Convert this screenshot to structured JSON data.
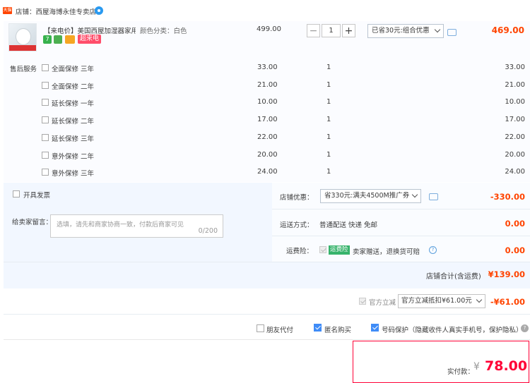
{
  "shop": {
    "badge": "天猫",
    "label": "店铺：西屋海博永佳专卖店"
  },
  "item": {
    "title": "【来电价】美国西屋加湿器家用...",
    "sku": "颜色分类：白色",
    "tag_seven": "7",
    "tag_hot": "超来电",
    "price": "499.00",
    "quantity": "1",
    "promo": "已省30元:组合优惠",
    "subtotal": "469.00"
  },
  "services": {
    "label": "售后服务",
    "rows": [
      {
        "name": "全面保修 三年",
        "price": "33.00",
        "qty": "1",
        "sum": "33.00"
      },
      {
        "name": "全面保修 二年",
        "price": "21.00",
        "qty": "1",
        "sum": "21.00"
      },
      {
        "name": "延长保修 一年",
        "price": "10.00",
        "qty": "1",
        "sum": "10.00"
      },
      {
        "name": "延长保修 二年",
        "price": "17.00",
        "qty": "1",
        "sum": "17.00"
      },
      {
        "name": "延长保修 三年",
        "price": "22.00",
        "qty": "1",
        "sum": "22.00"
      },
      {
        "name": "意外保修 二年",
        "price": "20.00",
        "qty": "1",
        "sum": "20.00"
      },
      {
        "name": "意外保修 三年",
        "price": "24.00",
        "qty": "1",
        "sum": "24.00"
      }
    ]
  },
  "invoice": {
    "label": "开具发票"
  },
  "memo": {
    "label": "给卖家留言：",
    "placeholder": "选填，请先和商家协商一致，付款后商家可见",
    "count": "0/200"
  },
  "shop_discount": {
    "label": "店铺优惠：",
    "value": "省330元:满夫4500M推广券",
    "amount": "-330.00"
  },
  "delivery": {
    "label": "运送方式：",
    "value": "普通配送 快递 免邮",
    "amount": "0.00"
  },
  "freight_insurance": {
    "label": "运费险：",
    "badge": "运费险",
    "text": "卖家赠送，退换货可赔",
    "amount": "0.00"
  },
  "shop_total": {
    "label": "店铺合计(含运费)",
    "amount": "¥139.00"
  },
  "official": {
    "label": "官方立减",
    "value": "官方立减抵扣¥61.00元",
    "amount": "-¥61.00"
  },
  "options": {
    "friend_pay": "朋友代付",
    "anonymous": "匿名购买",
    "number_protect": "号码保护（隐藏收件人真实手机号，保护隐私）"
  },
  "payment": {
    "label": "实付款：",
    "currency": "¥",
    "amount": "78.00"
  },
  "colors": {
    "accent": "#ff4400",
    "blue": "#3f8cf7",
    "pay_border": "#ff0036"
  }
}
